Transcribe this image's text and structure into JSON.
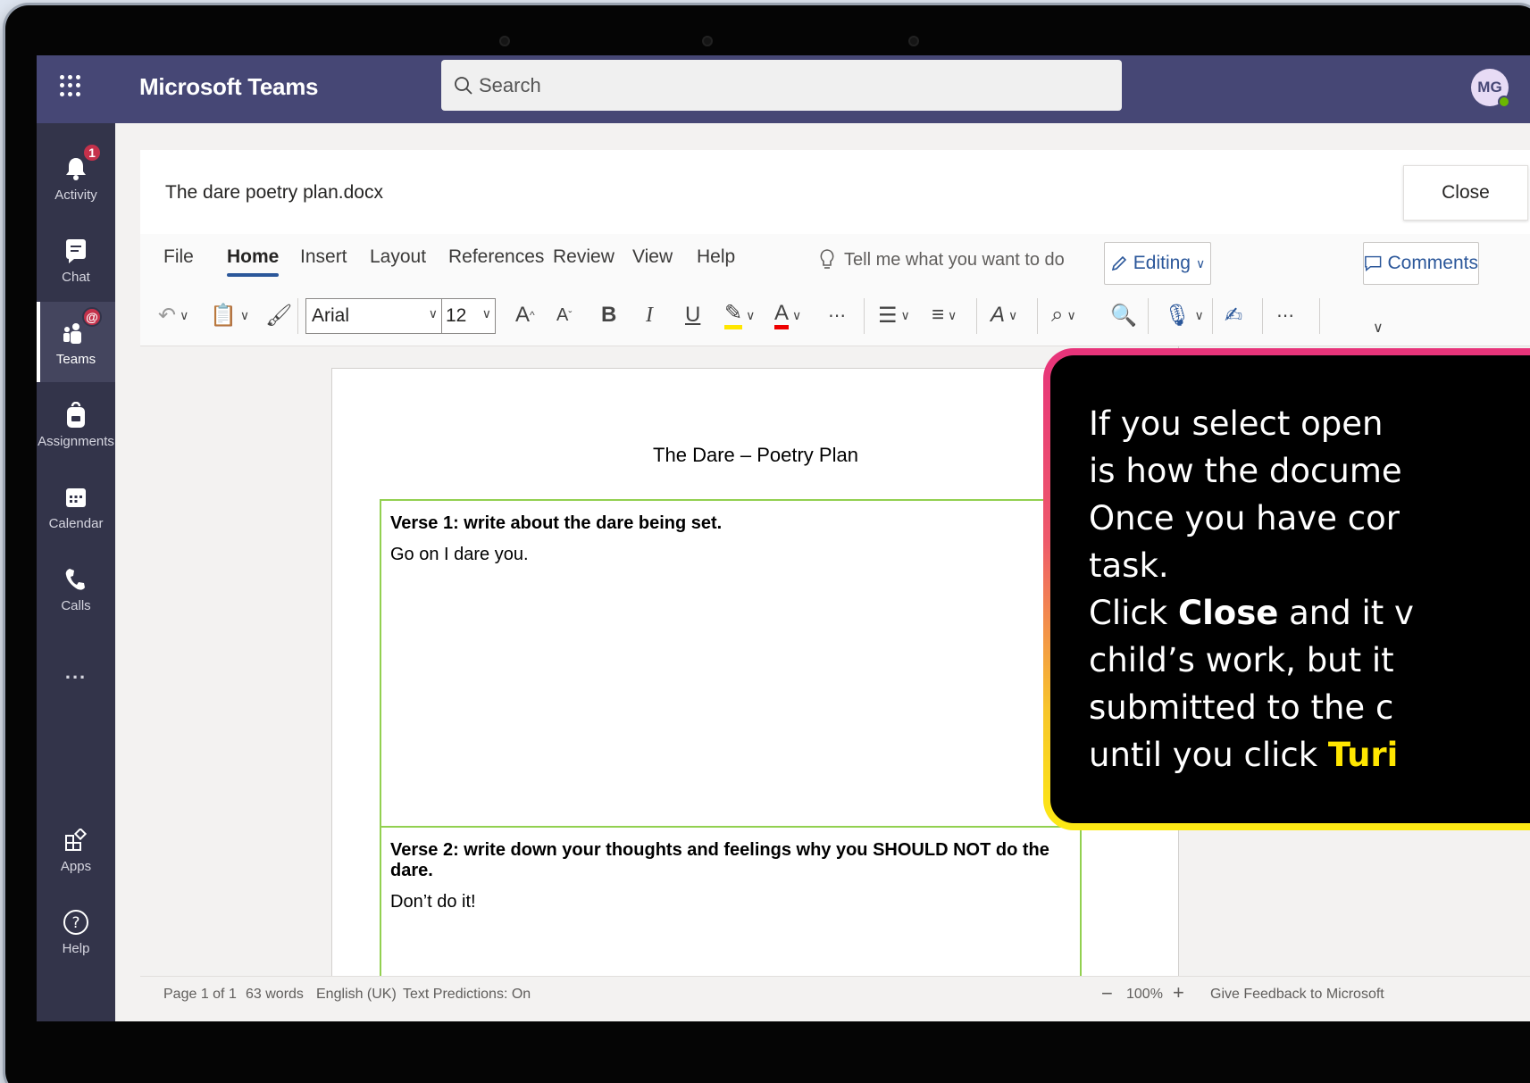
{
  "header": {
    "app_title": "Microsoft Teams",
    "search_placeholder": "Search",
    "avatar_initials": "MG"
  },
  "rail": {
    "items": [
      {
        "label": "Activity",
        "badge": "1"
      },
      {
        "label": "Chat"
      },
      {
        "label": "Teams",
        "badge": "@"
      },
      {
        "label": "Assignments"
      },
      {
        "label": "Calendar"
      },
      {
        "label": "Calls"
      },
      {
        "label": "..."
      },
      {
        "label": "Apps"
      },
      {
        "label": "Help"
      }
    ]
  },
  "document": {
    "file_name": "The dare poetry plan.docx",
    "close_label": "Close",
    "page_title": "The Dare – Poetry Plan",
    "rows": [
      {
        "heading": "Verse 1: write about the dare being set.",
        "body": "Go on I dare you."
      },
      {
        "heading": "Verse 2: write down your thoughts and feelings why you SHOULD NOT do the dare.",
        "body": "Don’t do it!"
      }
    ]
  },
  "ribbon": {
    "tabs": [
      "File",
      "Home",
      "Insert",
      "Layout",
      "References",
      "Review",
      "View",
      "Help"
    ],
    "active_tab": "Home",
    "tell_me": "Tell me what you want to do",
    "editing_label": "Editing",
    "comments_label": "Comments",
    "font_name": "Arial",
    "font_size": "12"
  },
  "status_bar": {
    "page": "Page 1 of 1",
    "words": "63 words",
    "language": "English (UK)",
    "predictions": "Text Predictions: On",
    "zoom": "100%",
    "feedback": "Give Feedback to Microsoft"
  },
  "callout": {
    "line1": "If you select open",
    "line2": "is how the docume",
    "line3": "Once you have cor",
    "line4": "task.",
    "line5_a": "Click ",
    "line5_b": "Close",
    "line5_c": " and it v",
    "line6": "child’s work, but it",
    "line7": "submitted to the c",
    "line8_a": "until you click ",
    "line8_b": "Turi"
  },
  "colors": {
    "teams_purple": "#464775",
    "rail": "#33344a",
    "word_blue": "#2b579a",
    "table_green": "#92d050",
    "callout_highlight": "#ffe600"
  }
}
